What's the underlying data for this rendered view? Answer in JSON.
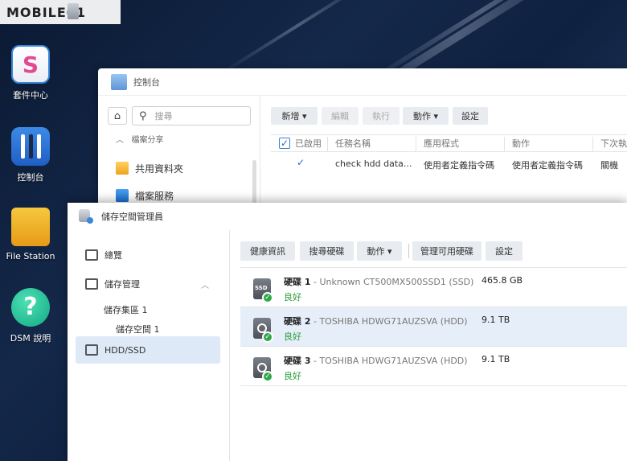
{
  "brand": {
    "logo_text": "MOBILE01"
  },
  "desktop": {
    "icons": [
      {
        "label": "套件中心",
        "icon": "package-center-icon"
      },
      {
        "label": "控制台",
        "icon": "control-panel-icon"
      },
      {
        "label": "File Station",
        "icon": "folder-icon"
      },
      {
        "label": "DSM 說明",
        "icon": "help-icon"
      }
    ]
  },
  "control_panel": {
    "title": "控制台",
    "search_placeholder": "搜尋",
    "section": "檔案分享",
    "items": [
      {
        "label": "共用資料夾",
        "icon": "shared-folder-icon"
      },
      {
        "label": "檔案服務",
        "icon": "file-services-icon"
      }
    ],
    "toolbar": {
      "create": "新增 ▾",
      "edit": "編輯",
      "run": "執行",
      "action": "動作 ▾",
      "settings": "設定"
    },
    "columns": [
      "已啟用",
      "任務名稱",
      "應用程式",
      "動作",
      "下次執"
    ],
    "rows": [
      {
        "enabled": true,
        "task": "check hdd data...",
        "app": "使用者定義指令碼",
        "action": "使用者定義指令碼",
        "next": "關機"
      }
    ]
  },
  "storage_manager": {
    "title": "儲存空間管理員",
    "nav": {
      "overview": "總覽",
      "storage": "儲存管理",
      "pool": "儲存集區 1",
      "volume": "儲存空間 1",
      "hdd_ssd": "HDD/SSD"
    },
    "toolbar": {
      "health": "健康資訊",
      "search": "搜尋硬碟",
      "action": "動作 ▾",
      "manage": "管理可用硬碟",
      "settings": "設定"
    },
    "disks": [
      {
        "name": "硬碟 1",
        "model": " - Unknown CT500MX500SSD1 (SSD)",
        "size": "465.8 GB",
        "status": "良好",
        "type": "SSD",
        "selected": false
      },
      {
        "name": "硬碟 2",
        "model": " - TOSHIBA HDWG71AUZSVA (HDD)",
        "size": "9.1 TB",
        "status": "良好",
        "type": "HDD",
        "selected": true
      },
      {
        "name": "硬碟 3",
        "model": " - TOSHIBA HDWG71AUZSVA (HDD)",
        "size": "9.1 TB",
        "status": "良好",
        "type": "HDD",
        "selected": false
      }
    ]
  }
}
